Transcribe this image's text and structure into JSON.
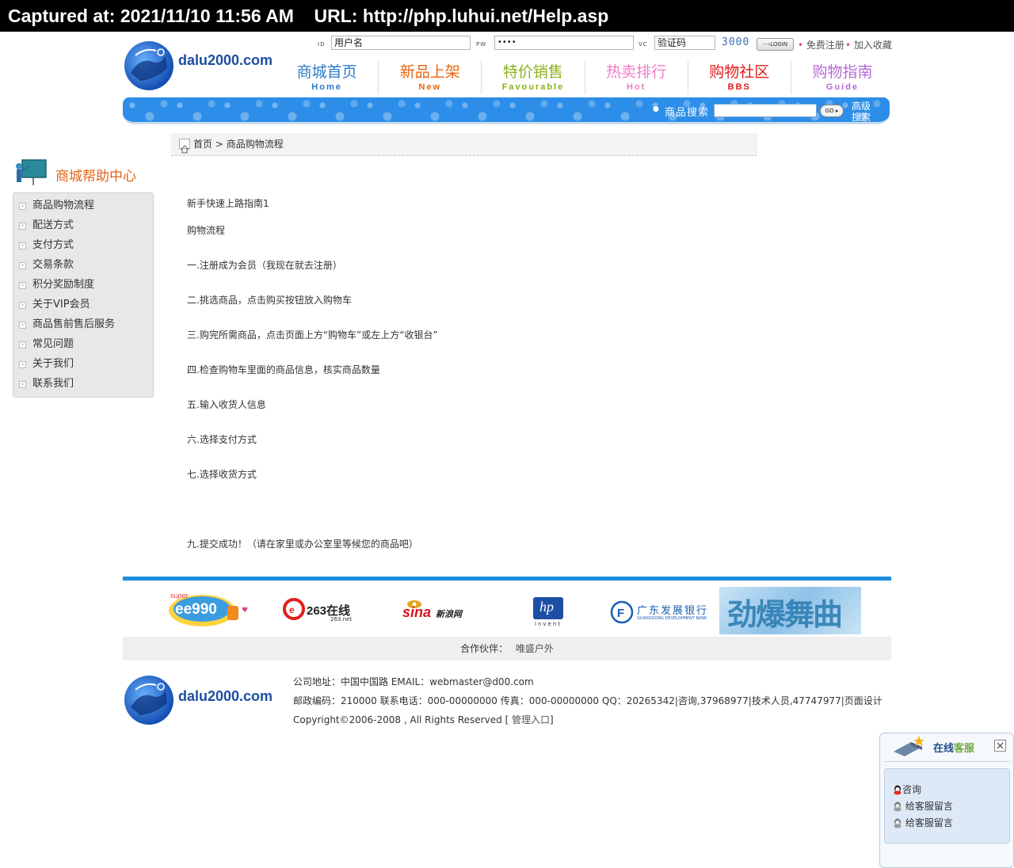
{
  "capture": {
    "text": "Captured at: 2021/11/10 11:56 AM    URL: http://php.luhui.net/Help.asp"
  },
  "header": {
    "logo_text": "dalu2000.com",
    "id_label": "ID",
    "id_value": "用户名",
    "pw_label": "PW",
    "pw_value": "••••",
    "vc_label": "VC",
    "vc_value": "验证码",
    "captcha": "3000",
    "login_label": "···›LOGIN",
    "register": "免费注册",
    "favorite": "加入收藏"
  },
  "nav": [
    {
      "zh": "商城首页",
      "en": "Home",
      "zh_color": "#2b7bc9",
      "en_color": "#2b7bc9"
    },
    {
      "zh": "新品上架",
      "en": "New",
      "zh_color": "#e8640c",
      "en_color": "#e8640c"
    },
    {
      "zh": "特价销售",
      "en": "Favourable",
      "zh_color": "#8ab21d",
      "en_color": "#8ab21d"
    },
    {
      "zh": "热卖排行",
      "en": "Hot",
      "zh_color": "#f07cc8",
      "en_color": "#f07cc8"
    },
    {
      "zh": "购物社区",
      "en": "BBS",
      "zh_color": "#e21a1a",
      "en_color": "#e21a1a"
    },
    {
      "zh": "购物指南",
      "en": "Guide",
      "zh_color": "#b56ad6",
      "en_color": "#b56ad6"
    }
  ],
  "search": {
    "label": "商品搜索",
    "go": "GO ▸",
    "advanced_1": "高级",
    "advanced_2": "搜索"
  },
  "breadcrumb": {
    "home": "首页",
    "sep": ">",
    "current": "商品购物流程"
  },
  "sidebar": {
    "title": "商城帮助中心",
    "items": [
      {
        "label": "商品购物流程"
      },
      {
        "label": "配送方式"
      },
      {
        "label": "支付方式"
      },
      {
        "label": "交易条款"
      },
      {
        "label": "积分奖励制度"
      },
      {
        "label": "关于VIP会员"
      },
      {
        "label": "商品售前售后服务"
      },
      {
        "label": "常见问题"
      },
      {
        "label": "关于我们"
      },
      {
        "label": "联系我们"
      }
    ]
  },
  "article": {
    "lines": [
      "新手快速上路指南1",
      "购物流程",
      "一.注册成为会员（我现在就去注册）",
      "二.挑选商品，点击购买按钮放入购物车",
      "三.购完所需商品，点击页面上方“购物车”或左上方“收银台”",
      "四.检查购物车里面的商品信息，核实商品数量",
      "五.输入收货人信息",
      "六.选择支付方式",
      "七.选择收货方式",
      "九.提交成功！（请在家里或办公室里等候您的商品吧）"
    ]
  },
  "partners": {
    "ee990": "ee990",
    "ee990_super": "super",
    "r263": "263在线",
    "r263_sub": "263.net",
    "sina": "sina",
    "sina_cn": "新浪网",
    "hp": "hp",
    "hp_sub": "invent",
    "gdb": "广东发展银行",
    "gdb_en": "GUANGDONG DEVELOPMENT BANK",
    "banner": "劲爆舞曲",
    "label": "合作伙伴：",
    "name": "唯盛户外"
  },
  "footer": {
    "line1": "公司地址：中国中国路    EMAIL：webmaster@d00.com",
    "line2": "邮政编码：210000    联系电话：000-00000000    传真：000-00000000    QQ：20265342|咨询,37968977|技术人员,47747977|页面设计",
    "line3_prefix": "Copyright©2006-2008 , All Rights Reserved [ ",
    "line3_link": "管理入口",
    "line3_suffix": "]"
  },
  "online_service": {
    "title_a": "在线",
    "title_b": "客服",
    "items": [
      {
        "label": "咨询"
      },
      {
        "label": "给客服留言"
      },
      {
        "label": "给客服留言"
      }
    ]
  }
}
